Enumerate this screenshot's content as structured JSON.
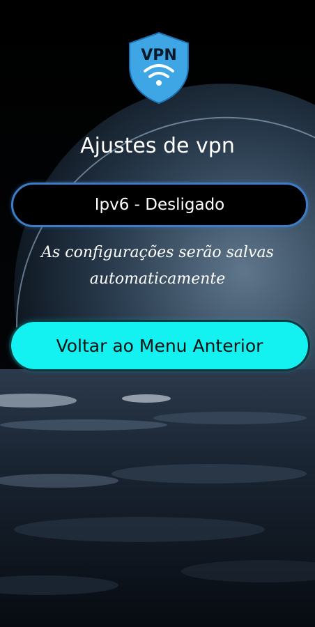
{
  "logo": {
    "text": "VPN",
    "icon": "shield-wifi-icon",
    "color": "#3fa6e6"
  },
  "title": "Ajustes de vpn",
  "ipv6_toggle": {
    "label": "Ipv6 - Desligado",
    "border_color": "#3d7dc8"
  },
  "note": {
    "line1": "As configurações serão salvas",
    "line2": "automaticamente"
  },
  "back_button": {
    "label": "Voltar ao Menu Anterior",
    "color": "#14f1f1"
  }
}
